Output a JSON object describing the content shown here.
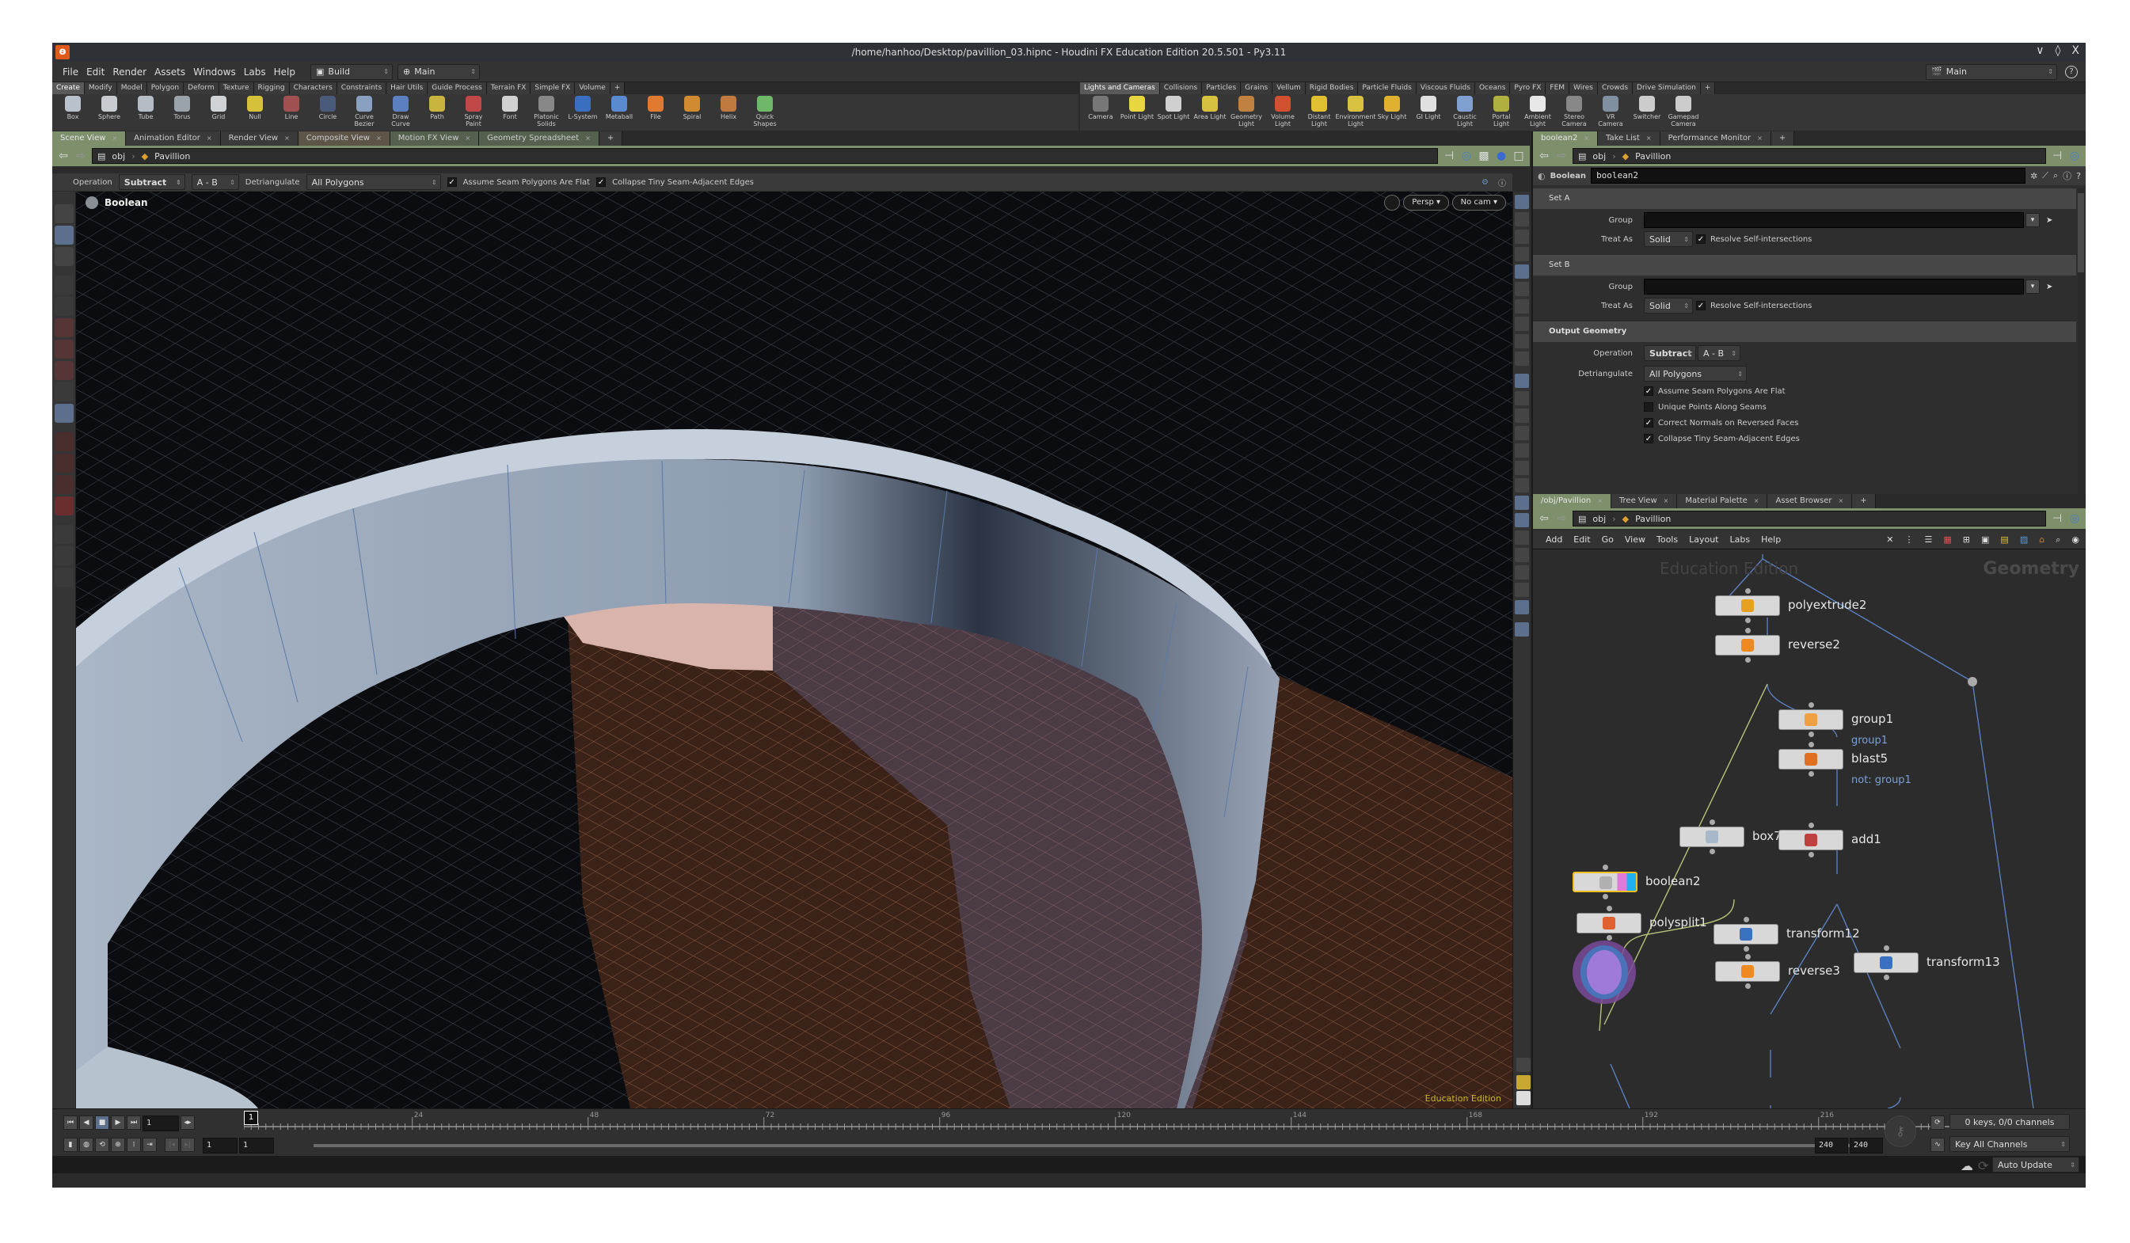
{
  "window": {
    "title": "/home/hanhoo/Desktop/pavillion_03.hipnc - Houdini FX Education Edition 20.5.501 - Py3.11",
    "controls": [
      "∨",
      "◊",
      "X"
    ]
  },
  "menubar": {
    "items": [
      "File",
      "Edit",
      "Render",
      "Assets",
      "Windows",
      "Labs",
      "Help"
    ],
    "desktop": "Build",
    "context": "Main",
    "right_context": "Main"
  },
  "shelf_left": {
    "tabs": [
      "Create",
      "Modify",
      "Model",
      "Polygon",
      "Deform",
      "Texture",
      "Rigging",
      "Characters",
      "Constraints",
      "Hair Utils",
      "Guide Process",
      "Terrain FX",
      "Simple FX",
      "Volume"
    ],
    "active_tab": "Create",
    "tools": [
      {
        "label": "Box",
        "color": "#b9c2cc"
      },
      {
        "label": "Sphere",
        "color": "#c8ccd0"
      },
      {
        "label": "Tube",
        "color": "#b5bcc4"
      },
      {
        "label": "Torus",
        "color": "#9aa2aa"
      },
      {
        "label": "Grid",
        "color": "#cfd3d6"
      },
      {
        "label": "Null",
        "color": "#d6c23a"
      },
      {
        "label": "Line",
        "color": "#a05050"
      },
      {
        "label": "Circle",
        "color": "#4a5a7a"
      },
      {
        "label": "Curve Bezier",
        "color": "#8aa0c0"
      },
      {
        "label": "Draw Curve",
        "color": "#5b7fbf"
      },
      {
        "label": "Path",
        "color": "#c9b440"
      },
      {
        "label": "Spray Paint",
        "color": "#c04848"
      },
      {
        "label": "Font",
        "color": "#d0d0d0"
      },
      {
        "label": "Platonic Solids",
        "color": "#888888"
      },
      {
        "label": "L-System",
        "color": "#3a6fc0"
      },
      {
        "label": "Metaball",
        "color": "#5a8ad0"
      },
      {
        "label": "File",
        "color": "#e07a30"
      },
      {
        "label": "Spiral",
        "color": "#d08a30"
      },
      {
        "label": "Helix",
        "color": "#c07a40"
      },
      {
        "label": "Quick Shapes",
        "color": "#6fb86a"
      }
    ]
  },
  "shelf_right": {
    "tabs": [
      "Lights and Cameras",
      "Collisions",
      "Particles",
      "Grains",
      "Vellum",
      "Rigid Bodies",
      "Particle Fluids",
      "Viscous Fluids",
      "Oceans",
      "Pyro FX",
      "FEM",
      "Wires",
      "Crowds",
      "Drive Simulation"
    ],
    "active_tab": "Lights and Cameras",
    "tools": [
      {
        "label": "Camera",
        "color": "#777777"
      },
      {
        "label": "Point Light",
        "color": "#e8d640"
      },
      {
        "label": "Spot Light",
        "color": "#d0d0d0"
      },
      {
        "label": "Area Light",
        "color": "#d6c040"
      },
      {
        "label": "Geometry Light",
        "color": "#c08040"
      },
      {
        "label": "Volume Light",
        "color": "#d05030"
      },
      {
        "label": "Distant Light",
        "color": "#e0c030"
      },
      {
        "label": "Environment Light",
        "color": "#d8c040"
      },
      {
        "label": "Sky Light",
        "color": "#e0b030"
      },
      {
        "label": "GI Light",
        "color": "#e0e0e0"
      },
      {
        "label": "Caustic Light",
        "color": "#7fa0d0"
      },
      {
        "label": "Portal Light",
        "color": "#b0b040"
      },
      {
        "label": "Ambient Light",
        "color": "#e8e8e8"
      },
      {
        "label": "Stereo Camera",
        "color": "#888888"
      },
      {
        "label": "VR Camera",
        "color": "#8090a0"
      },
      {
        "label": "Switcher",
        "color": "#cccccc"
      },
      {
        "label": "Gamepad Camera",
        "color": "#cccccc"
      }
    ]
  },
  "left_pane": {
    "tabs": [
      {
        "label": "Scene View",
        "style": "active"
      },
      {
        "label": "Animation Editor",
        "style": ""
      },
      {
        "label": "Render View",
        "style": ""
      },
      {
        "label": "Composite View",
        "style": "warm"
      },
      {
        "label": "Motion FX View",
        "style": "green"
      },
      {
        "label": "Geometry Spreadsheet",
        "style": "green"
      }
    ],
    "path": [
      "obj",
      "Pavillion"
    ],
    "operation_bar": {
      "operation_label": "Operation",
      "operation_value": "Subtract",
      "ab_value": "A - B",
      "detriangulate_label": "Detriangulate",
      "detriangulate_value": "All Polygons",
      "check1": "Assume Seam Polygons Are Flat",
      "check2": "Collapse Tiny Seam-Adjacent Edges"
    },
    "viewport": {
      "node_label": "Boolean",
      "view_mode": "Persp",
      "camera": "No cam",
      "watermark": "Education Edition"
    }
  },
  "params_pane": {
    "tabs": [
      {
        "label": "boolean2",
        "style": "active"
      },
      {
        "label": "Take List",
        "style": ""
      },
      {
        "label": "Performance Monitor",
        "style": ""
      }
    ],
    "path": [
      "obj",
      "Pavillion"
    ],
    "node_type": "Boolean",
    "node_name": "boolean2",
    "set_a": {
      "header": "Set A",
      "group_label": "Group",
      "group_value": "",
      "treat_as_label": "Treat As",
      "treat_as_value": "Solid",
      "resolve_label": "Resolve Self-intersections",
      "resolve_checked": true
    },
    "set_b": {
      "header": "Set B",
      "group_label": "Group",
      "group_value": "",
      "treat_as_label": "Treat As",
      "treat_as_value": "Solid",
      "resolve_label": "Resolve Self-intersections",
      "resolve_checked": true
    },
    "output": {
      "header": "Output Geometry",
      "operation_label": "Operation",
      "operation_value": "Subtract",
      "ab_value": "A - B",
      "detriangulate_label": "Detriangulate",
      "detriangulate_value": "All Polygons",
      "checks": [
        {
          "label": "Assume Seam Polygons Are Flat",
          "checked": true
        },
        {
          "label": "Unique Points Along Seams",
          "checked": false
        },
        {
          "label": "Correct Normals on Reversed Faces",
          "checked": true
        },
        {
          "label": "Collapse Tiny Seam-Adjacent Edges",
          "checked": true
        }
      ]
    }
  },
  "network_pane": {
    "tabs": [
      {
        "label": "/obj/Pavillion",
        "style": "active"
      },
      {
        "label": "Tree View",
        "style": ""
      },
      {
        "label": "Material Palette",
        "style": ""
      },
      {
        "label": "Asset Browser",
        "style": ""
      }
    ],
    "path": [
      "obj",
      "Pavillion"
    ],
    "menu": [
      "Add",
      "Edit",
      "Go",
      "View",
      "Tools",
      "Layout",
      "Labs",
      "Help"
    ],
    "watermark": "Education Edition",
    "context_label": "Geometry",
    "nodes": [
      {
        "name": "polyextrude2",
        "icon": "polyextrude-icon",
        "color": "#e8a020",
        "sub": ""
      },
      {
        "name": "reverse2",
        "icon": "reverse-icon",
        "color": "#f08a20",
        "sub": ""
      },
      {
        "name": "group1",
        "icon": "group-icon",
        "color": "#f0a040",
        "sub": "group1"
      },
      {
        "name": "blast5",
        "icon": "blast-icon",
        "color": "#e07020",
        "sub": "not: group1"
      },
      {
        "name": "box7",
        "icon": "box-icon",
        "color": "#a8b8c8",
        "sub": ""
      },
      {
        "name": "add1",
        "icon": "add-icon",
        "color": "#c04040",
        "sub": ""
      },
      {
        "name": "boolean2",
        "icon": "boolean-icon",
        "color": "#b0b0b0",
        "sub": ""
      },
      {
        "name": "polysplit1",
        "icon": "polysplit-icon",
        "color": "#e06030",
        "sub": ""
      },
      {
        "name": "transform12",
        "icon": "transform-icon",
        "color": "#3a70c0",
        "sub": ""
      },
      {
        "name": "reverse3",
        "icon": "reverse-icon",
        "color": "#f08a20",
        "sub": ""
      },
      {
        "name": "transform13",
        "icon": "transform-icon",
        "color": "#3a70c0",
        "sub": ""
      }
    ]
  },
  "timeline": {
    "current_frame": "1",
    "frame_marker": "1",
    "ticks": [
      "24",
      "48",
      "72",
      "96",
      "120",
      "144",
      "168",
      "192",
      "216"
    ],
    "range_start": "1",
    "range_start2": "1",
    "range_end": "240",
    "range_end2": "240",
    "keys_status": "0 keys, 0/0 channels",
    "key_mode": "Key All Channels"
  },
  "statusbar": {
    "update_mode": "Auto Update"
  }
}
